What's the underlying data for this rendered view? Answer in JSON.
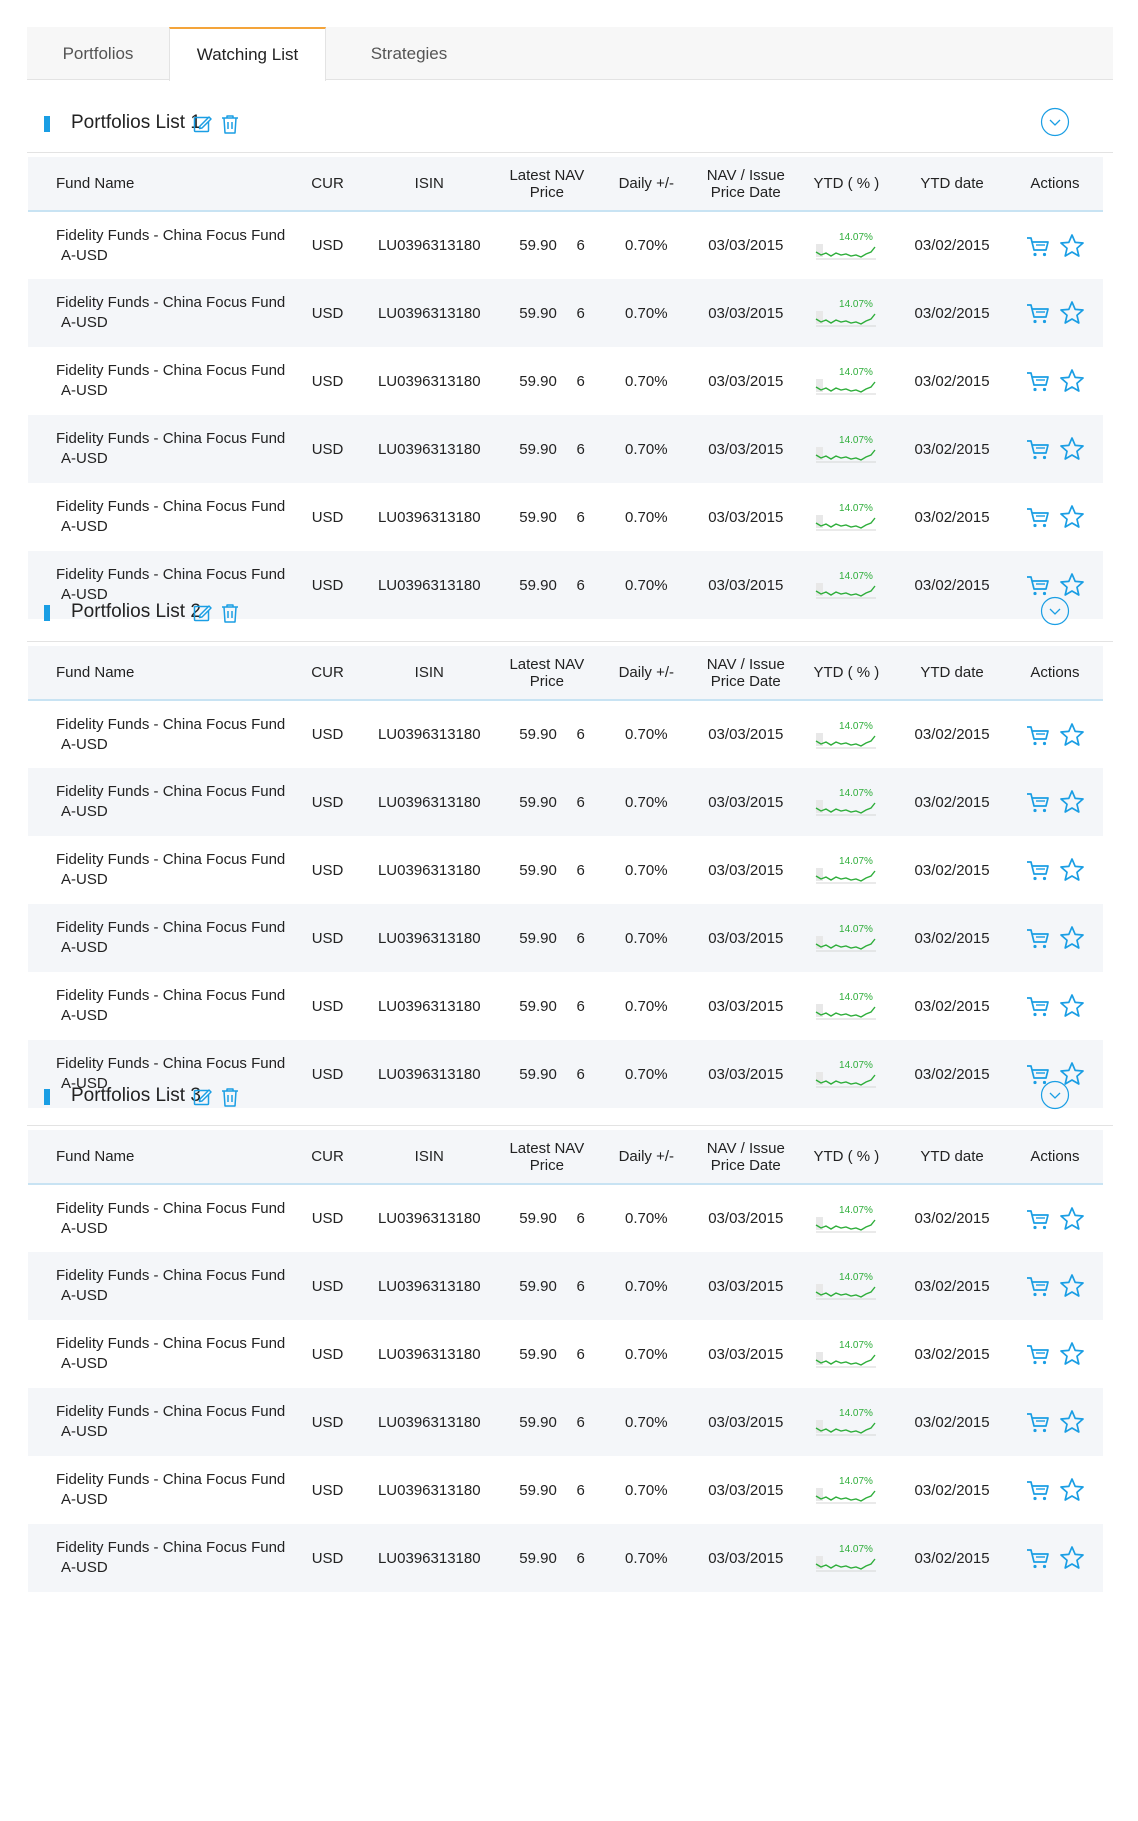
{
  "tabs": [
    {
      "label": "Portfolios"
    },
    {
      "label": "Watching List"
    },
    {
      "label": "Strategies"
    }
  ],
  "columns": {
    "fund_name": "Fund Name",
    "cur": "CUR",
    "isin": "ISIN",
    "nav_line1": "Latest NAV",
    "nav_line2": "Price",
    "daily": "Daily +/-",
    "date_line1": "NAV / Issue",
    "date_line2": "Price Date",
    "ytd": "YTD ( % )",
    "ytd_date": "YTD date",
    "actions": "Actions"
  },
  "colors": {
    "accent": "#1a9ee4",
    "active_tab": "#f4a43a",
    "spark_green": "#2fae3b"
  },
  "icons": {
    "edit": "edit-icon",
    "delete": "trash-icon",
    "toggle": "chevron-down-circle-icon",
    "buy": "cart-icon",
    "watch": "star-icon"
  },
  "sections": [
    {
      "title": "Portfolios List 1",
      "rows": [
        {
          "name1": "Fidelity Funds - China Focus Fund",
          "name2": "A-USD",
          "cur": "USD",
          "isin": "LU0396313180",
          "nav": "59.90",
          "nav_n": "6",
          "daily": "0.70%",
          "nav_date": "03/03/2015",
          "ytd": "14.07%",
          "ytd_date": "03/02/2015"
        },
        {
          "name1": "Fidelity Funds - China Focus Fund",
          "name2": "A-USD",
          "cur": "USD",
          "isin": "LU0396313180",
          "nav": "59.90",
          "nav_n": "6",
          "daily": "0.70%",
          "nav_date": "03/03/2015",
          "ytd": "14.07%",
          "ytd_date": "03/02/2015"
        },
        {
          "name1": "Fidelity Funds - China Focus Fund",
          "name2": "A-USD",
          "cur": "USD",
          "isin": "LU0396313180",
          "nav": "59.90",
          "nav_n": "6",
          "daily": "0.70%",
          "nav_date": "03/03/2015",
          "ytd": "14.07%",
          "ytd_date": "03/02/2015"
        },
        {
          "name1": "Fidelity Funds - China Focus Fund",
          "name2": "A-USD",
          "cur": "USD",
          "isin": "LU0396313180",
          "nav": "59.90",
          "nav_n": "6",
          "daily": "0.70%",
          "nav_date": "03/03/2015",
          "ytd": "14.07%",
          "ytd_date": "03/02/2015"
        },
        {
          "name1": "Fidelity Funds - China Focus Fund",
          "name2": "A-USD",
          "cur": "USD",
          "isin": "LU0396313180",
          "nav": "59.90",
          "nav_n": "6",
          "daily": "0.70%",
          "nav_date": "03/03/2015",
          "ytd": "14.07%",
          "ytd_date": "03/02/2015"
        },
        {
          "name1": "Fidelity Funds - China Focus Fund",
          "name2": "A-USD",
          "cur": "USD",
          "isin": "LU0396313180",
          "nav": "59.90",
          "nav_n": "6",
          "daily": "0.70%",
          "nav_date": "03/03/2015",
          "ytd": "14.07%",
          "ytd_date": "03/02/2015"
        }
      ]
    },
    {
      "title": "Portfolios List 2",
      "rows": [
        {
          "name1": "Fidelity Funds - China Focus Fund",
          "name2": "A-USD",
          "cur": "USD",
          "isin": "LU0396313180",
          "nav": "59.90",
          "nav_n": "6",
          "daily": "0.70%",
          "nav_date": "03/03/2015",
          "ytd": "14.07%",
          "ytd_date": "03/02/2015"
        },
        {
          "name1": "Fidelity Funds - China Focus Fund",
          "name2": "A-USD",
          "cur": "USD",
          "isin": "LU0396313180",
          "nav": "59.90",
          "nav_n": "6",
          "daily": "0.70%",
          "nav_date": "03/03/2015",
          "ytd": "14.07%",
          "ytd_date": "03/02/2015"
        },
        {
          "name1": "Fidelity Funds - China Focus Fund",
          "name2": "A-USD",
          "cur": "USD",
          "isin": "LU0396313180",
          "nav": "59.90",
          "nav_n": "6",
          "daily": "0.70%",
          "nav_date": "03/03/2015",
          "ytd": "14.07%",
          "ytd_date": "03/02/2015"
        },
        {
          "name1": "Fidelity Funds - China Focus Fund",
          "name2": "A-USD",
          "cur": "USD",
          "isin": "LU0396313180",
          "nav": "59.90",
          "nav_n": "6",
          "daily": "0.70%",
          "nav_date": "03/03/2015",
          "ytd": "14.07%",
          "ytd_date": "03/02/2015"
        },
        {
          "name1": "Fidelity Funds - China Focus Fund",
          "name2": "A-USD",
          "cur": "USD",
          "isin": "LU0396313180",
          "nav": "59.90",
          "nav_n": "6",
          "daily": "0.70%",
          "nav_date": "03/03/2015",
          "ytd": "14.07%",
          "ytd_date": "03/02/2015"
        },
        {
          "name1": "Fidelity Funds - China Focus Fund",
          "name2": "A-USD",
          "cur": "USD",
          "isin": "LU0396313180",
          "nav": "59.90",
          "nav_n": "6",
          "daily": "0.70%",
          "nav_date": "03/03/2015",
          "ytd": "14.07%",
          "ytd_date": "03/02/2015"
        }
      ]
    },
    {
      "title": "Portfolios List 3",
      "rows": [
        {
          "name1": "Fidelity Funds - China Focus Fund",
          "name2": "A-USD",
          "cur": "USD",
          "isin": "LU0396313180",
          "nav": "59.90",
          "nav_n": "6",
          "daily": "0.70%",
          "nav_date": "03/03/2015",
          "ytd": "14.07%",
          "ytd_date": "03/02/2015"
        },
        {
          "name1": "Fidelity Funds - China Focus Fund",
          "name2": "A-USD",
          "cur": "USD",
          "isin": "LU0396313180",
          "nav": "59.90",
          "nav_n": "6",
          "daily": "0.70%",
          "nav_date": "03/03/2015",
          "ytd": "14.07%",
          "ytd_date": "03/02/2015"
        },
        {
          "name1": "Fidelity Funds - China Focus Fund",
          "name2": "A-USD",
          "cur": "USD",
          "isin": "LU0396313180",
          "nav": "59.90",
          "nav_n": "6",
          "daily": "0.70%",
          "nav_date": "03/03/2015",
          "ytd": "14.07%",
          "ytd_date": "03/02/2015"
        },
        {
          "name1": "Fidelity Funds - China Focus Fund",
          "name2": "A-USD",
          "cur": "USD",
          "isin": "LU0396313180",
          "nav": "59.90",
          "nav_n": "6",
          "daily": "0.70%",
          "nav_date": "03/03/2015",
          "ytd": "14.07%",
          "ytd_date": "03/02/2015"
        },
        {
          "name1": "Fidelity Funds - China Focus Fund",
          "name2": "A-USD",
          "cur": "USD",
          "isin": "LU0396313180",
          "nav": "59.90",
          "nav_n": "6",
          "daily": "0.70%",
          "nav_date": "03/03/2015",
          "ytd": "14.07%",
          "ytd_date": "03/02/2015"
        },
        {
          "name1": "Fidelity Funds - China Focus Fund",
          "name2": "A-USD",
          "cur": "USD",
          "isin": "LU0396313180",
          "nav": "59.90",
          "nav_n": "6",
          "daily": "0.70%",
          "nav_date": "03/03/2015",
          "ytd": "14.07%",
          "ytd_date": "03/02/2015"
        }
      ]
    }
  ]
}
